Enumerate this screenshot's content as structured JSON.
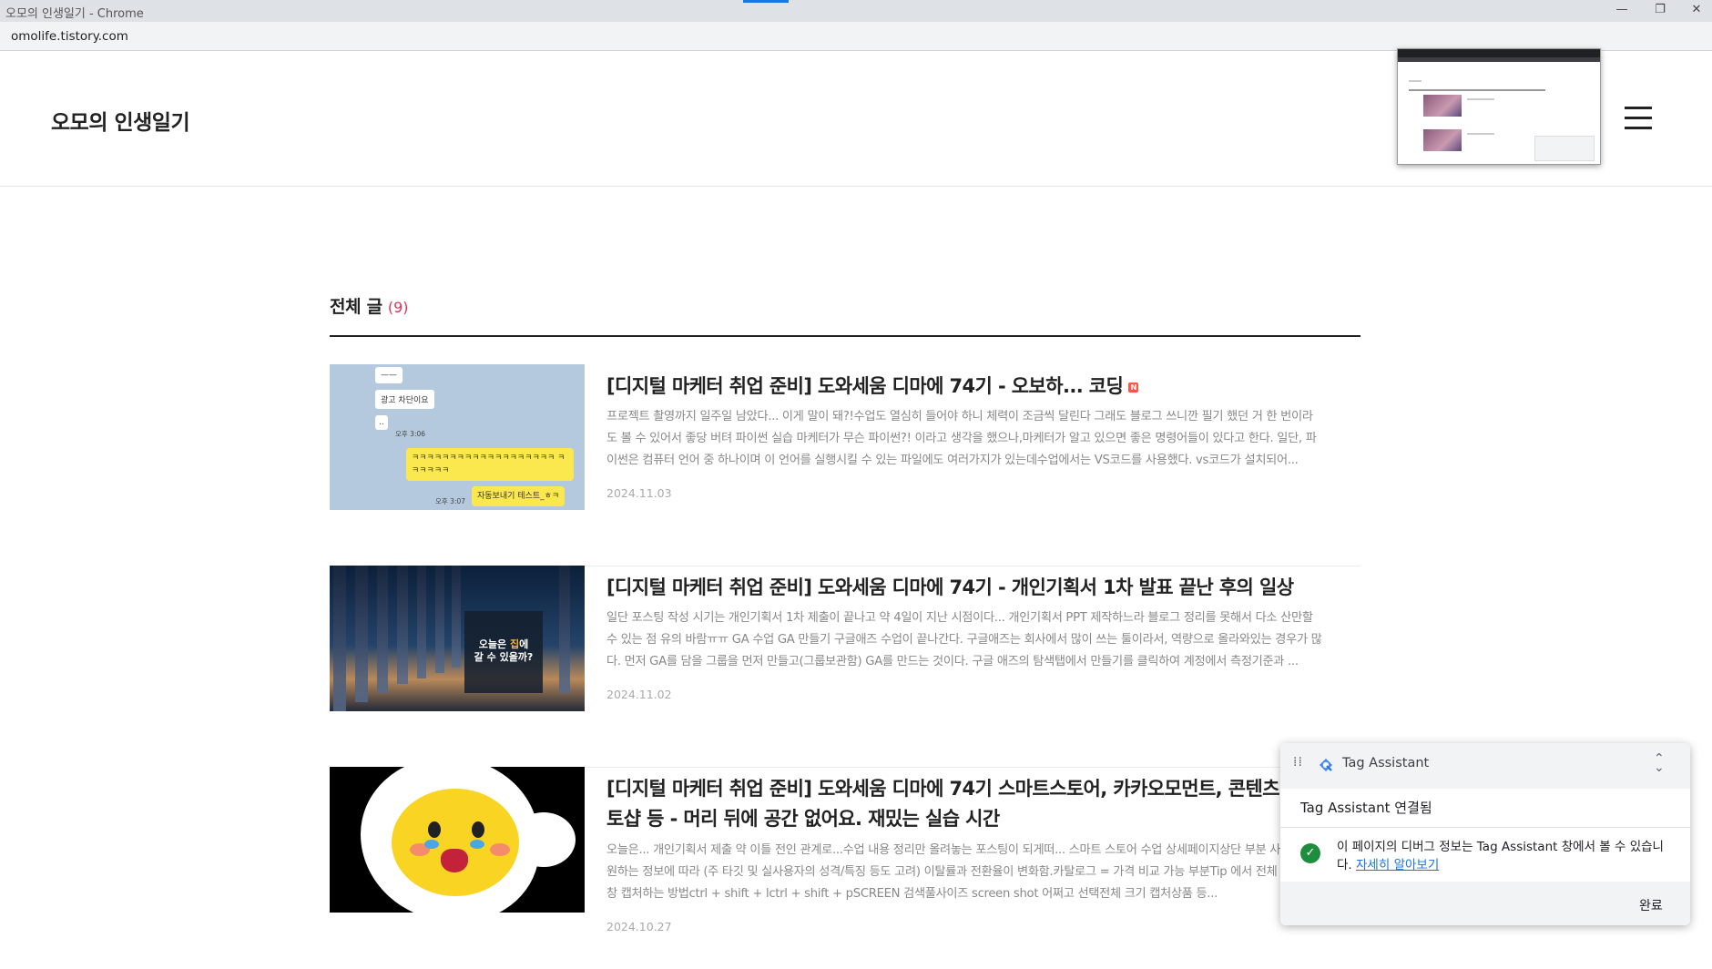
{
  "window": {
    "title": "오모의 인생일기 - Chrome",
    "minimize": "—",
    "restore": "❐",
    "close": "✕"
  },
  "address": {
    "url": "omolife.tistory.com"
  },
  "blog": {
    "title": "오모의 인생일기",
    "menu_icon": "hamburger-icon"
  },
  "section": {
    "label": "전체 글",
    "count": "(9)"
  },
  "posts": [
    {
      "title": "[디지털 마케터 취업 준비] 도와세움 디마에 74기 - 오보하... 코딩",
      "badge": "N",
      "excerpt": "프로젝트 촬영까지 일주일 남았다... 이게 말이 돼?!수업도 열심히 들어야 하니 체력이 조금씩 달린다 그래도 블로그 쓰니깐 필기 했던 거 한 번이라도 볼 수 있어서 좋당  버텨  파이썬 실습 마케터가 무슨 파이썬?! 이라고 생각을 했으나,마케터가 알고 있으면 좋은 명령어들이 있다고 한다.  일단, 파이썬은 컴퓨터 언어 중 하나이며 이 언어를 실행시킬 수 있는 파일에도 여러가지가 있는데수업에서는 VS코드를 사용했다.  vs코드가 설치되어...",
      "date": "2024.11.03",
      "thumb": {
        "b1": "——",
        "b2": "광고 차단이요",
        "b3": "..",
        "t1": "오후 3:06",
        "y1": "ㅋㅋㅋㅋㅋㅋㅋㅋㅋㅋㅋㅋㅋㅋㅋㅋㅋㅋㅋ ㅋㅋㅋㅋㅋㅋ",
        "t2": "오후 3:07",
        "y2": "자동보내기 테스트_ㅎㅋ"
      }
    },
    {
      "title": "[디지털 마케터 취업 준비] 도와세움 디마에 74기 - 개인기획서 1차 발표 끝난 후의 일상",
      "excerpt": "일단 포스팅 작성 시기는 개인기획서 1차 제출이 끝나고 약 4일이 지난 시점이다... 개인기획서 PPT 제작하느라 블로그 정리를 못해서 다소 산만할 수 있는 점 유의 바람ㅠㅠ GA 수업 GA 만들기 구글애즈 수업이 끝나간다. 구글애즈는 회사에서 많이 쓰는 툴이라서, 역량으로 올라와있는 경우가 많다. 먼저 GA를 담을 그룹을 먼저 만들고(그룹보관함) GA를 만드는 것이다. 구글 애즈의 탐색탭에서 만들기를 클릭하여 계정에서 측정기준과 ...",
      "date": "2024.11.02",
      "thumb": {
        "line1_a": "오늘은 ",
        "line1_b": "집",
        "line1_c": "에",
        "line2": "갈 수 있을까?"
      }
    },
    {
      "title": "[디지털 마케터 취업 준비] 도와세움 디마에 74기 스마트스토어, 카카오모먼트, 콘텐츠 마케팅, 토샵 등 - 머리 뒤에 공간 없어요. 재밌는 실습 시간",
      "excerpt": "오늘은... 개인기획서 제출 약 이틀 전인 관계로...수업 내용 정리만 올려놓는 포스팅이 되게떠...     스마트 스토어 수업 상세페이지상단 부분 사람들이 원하는 정보에 따라 (주 타깃 및 실사용자의 성격/특징 등도 고려) 이탈률과 전환율이 변화함.카탈로그 = 가격 비교 가능 부분Tip 에서 전체 스크롤 창 캡처하는 방법ctrl + shift + lctrl + shift + pSCREEN 검색풀사이즈 screen shot 어쩌고 선택전체 크기 캡처상품 등...",
      "date": "2024.10.27"
    }
  ],
  "tag_assistant": {
    "name": "Tag Assistant",
    "status": "Tag Assistant 연결됨",
    "message": "이 페이지의 디버그 정보는 Tag Assistant 창에서 볼 수 있습니다.",
    "link": "자세히 알아보기",
    "done": "완료",
    "collapse_icon": "collapse-icon",
    "check_icon": "check-circle-icon"
  },
  "colors": {
    "accent_count": "#e0335b",
    "link": "#1a73e8",
    "check": "#1e8e3e",
    "tab_indicator": "#1a73e8"
  }
}
